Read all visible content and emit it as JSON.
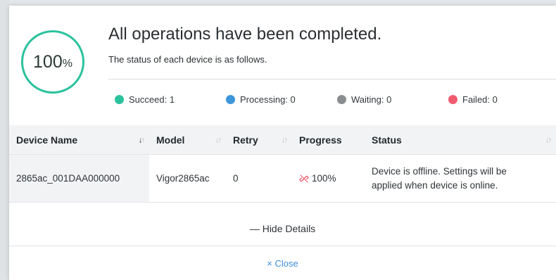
{
  "dialog": {
    "progress_value": "100",
    "progress_unit": "%",
    "title": "All operations have been completed.",
    "subtitle": "The status of each device is as follows."
  },
  "legend": [
    {
      "label": "Succeed: 1",
      "color": "#2bc29e"
    },
    {
      "label": "Processing: 0",
      "color": "#3d95dc"
    },
    {
      "label": "Waiting: 0",
      "color": "#8a8d90"
    },
    {
      "label": "Failed: 0",
      "color": "#ef5b6e"
    }
  ],
  "table": {
    "columns": [
      "Device Name",
      "Model",
      "Retry",
      "Progress",
      "Status"
    ],
    "rows": [
      {
        "device_name": "2865ac_001DAA000000",
        "model": "Vigor2865ac",
        "retry": "0",
        "progress_icon": "broken-link-icon",
        "progress": "100%",
        "status_line1": "Device is offline. Settings will be",
        "status_line2": "applied when device is online."
      }
    ]
  },
  "actions": {
    "hide_details": "— Hide Details",
    "close": "× Close"
  },
  "colors": {
    "accent": "#2bc29e",
    "link": "#3d8fdc",
    "fail": "#ef5b6e"
  }
}
